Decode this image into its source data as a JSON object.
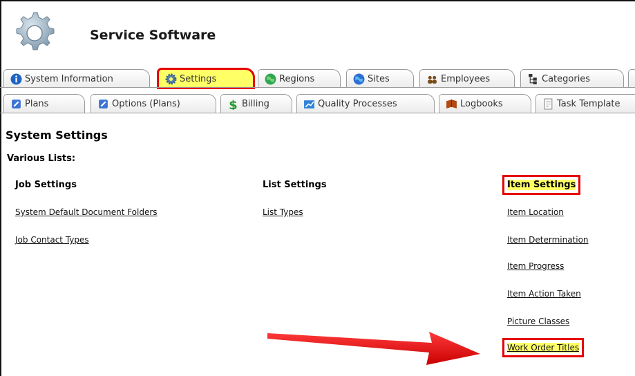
{
  "app": {
    "title": "Service Software"
  },
  "tabs_row1": [
    {
      "label": "System Information",
      "icon": "info-icon"
    },
    {
      "label": "Settings",
      "icon": "gear-icon",
      "active": true
    },
    {
      "label": "Regions",
      "icon": "globe-icon"
    },
    {
      "label": "Sites",
      "icon": "globe-icon"
    },
    {
      "label": "Employees",
      "icon": "people-icon"
    },
    {
      "label": "Categories",
      "icon": "hierarchy-icon"
    }
  ],
  "tabs_row2": [
    {
      "label": "Plans",
      "icon": "plan-icon"
    },
    {
      "label": "Options (Plans)",
      "icon": "plan-icon"
    },
    {
      "label": "Billing",
      "icon": "dollar-icon"
    },
    {
      "label": "Quality Processes",
      "icon": "chart-icon"
    },
    {
      "label": "Logbooks",
      "icon": "book-icon"
    },
    {
      "label": "Task Template",
      "icon": "document-icon"
    }
  ],
  "page": {
    "title": "System Settings",
    "subtitle": "Various Lists:"
  },
  "columns": {
    "job": {
      "heading": "Job Settings",
      "links": [
        "System Default Document Folders",
        "Job Contact Types"
      ]
    },
    "list": {
      "heading": "List Settings",
      "links": [
        "List Types"
      ]
    },
    "item": {
      "heading": "Item Settings",
      "links": [
        "Item Location",
        "Item Determination",
        "Item Progress",
        "Item Action Taken",
        "Picture Classes",
        "Work Order Titles"
      ]
    }
  },
  "colors": {
    "highlight": "#ffff66",
    "callout_red": "#e60000"
  }
}
